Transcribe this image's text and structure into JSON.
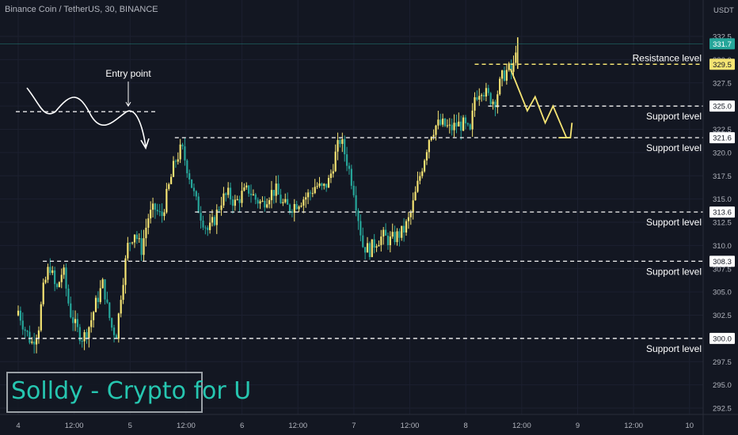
{
  "header": {
    "symbol": "Binance Coin / TetherUS, 30, BINANCE",
    "currency": "USDT"
  },
  "watermark": "Solldy - Crypto for U",
  "colors": {
    "up": "#f5e473",
    "down": "#26a69a",
    "background": "#131722",
    "level_line": "#e6e6e6",
    "resistance_line": "#f5e473",
    "annotation": "#f5e473",
    "price_tag": "#26a69a"
  },
  "chart_data": {
    "type": "candlestick",
    "title": "Binance Coin / TetherUS, 30, BINANCE",
    "ylabel": "USDT",
    "ylim": [
      291.5,
      334.5
    ],
    "x_ticks": [
      "4",
      "12:00",
      "5",
      "12:00",
      "6",
      "12:00",
      "7",
      "12:00",
      "8",
      "12:00",
      "9",
      "12:00",
      "10"
    ],
    "y_ticks": [
      292.5,
      295.0,
      297.5,
      300.0,
      302.5,
      305.0,
      307.5,
      310.0,
      312.5,
      315.0,
      317.5,
      320.0,
      322.5,
      325.0,
      327.5,
      330.0,
      332.5
    ],
    "last_price": 331.7,
    "price_markers": [
      331.7,
      329.5,
      325.0,
      321.6,
      313.6,
      308.3,
      300.0
    ],
    "levels": [
      {
        "label": "Resistance level",
        "price": 329.5,
        "kind": "resistance"
      },
      {
        "label": "Support level",
        "price": 325.0,
        "kind": "support"
      },
      {
        "label": "Support level",
        "price": 321.6,
        "kind": "support"
      },
      {
        "label": "Support level",
        "price": 313.6,
        "kind": "support"
      },
      {
        "label": "Support level",
        "price": 308.3,
        "kind": "support"
      },
      {
        "label": "Support level",
        "price": 300.0,
        "kind": "support"
      }
    ],
    "annotations": [
      {
        "text": "Entry point",
        "price": 324.4
      }
    ],
    "path_points": [
      {
        "day": 4.0,
        "price": 303.0
      },
      {
        "day": 4.06,
        "price": 301.0
      },
      {
        "day": 4.12,
        "price": 299.5
      },
      {
        "day": 4.18,
        "price": 301.0
      },
      {
        "day": 4.22,
        "price": 305.0
      },
      {
        "day": 4.28,
        "price": 308.0
      },
      {
        "day": 4.34,
        "price": 305.0
      },
      {
        "day": 4.4,
        "price": 307.5
      },
      {
        "day": 4.46,
        "price": 303.0
      },
      {
        "day": 4.52,
        "price": 301.0
      },
      {
        "day": 4.58,
        "price": 300.0
      },
      {
        "day": 4.64,
        "price": 301.5
      },
      {
        "day": 4.7,
        "price": 304.0
      },
      {
        "day": 4.76,
        "price": 306.0
      },
      {
        "day": 4.8,
        "price": 303.0
      },
      {
        "day": 4.84,
        "price": 301.0
      },
      {
        "day": 4.88,
        "price": 300.5
      },
      {
        "day": 4.92,
        "price": 305.0
      },
      {
        "day": 4.98,
        "price": 310.0
      },
      {
        "day": 5.04,
        "price": 311.5
      },
      {
        "day": 5.1,
        "price": 309.5
      },
      {
        "day": 5.16,
        "price": 313.0
      },
      {
        "day": 5.22,
        "price": 314.0
      },
      {
        "day": 5.28,
        "price": 313.0
      },
      {
        "day": 5.34,
        "price": 316.0
      },
      {
        "day": 5.4,
        "price": 319.0
      },
      {
        "day": 5.46,
        "price": 320.5
      },
      {
        "day": 5.52,
        "price": 318.0
      },
      {
        "day": 5.58,
        "price": 315.0
      },
      {
        "day": 5.64,
        "price": 313.0
      },
      {
        "day": 5.7,
        "price": 311.5
      },
      {
        "day": 5.76,
        "price": 313.0
      },
      {
        "day": 5.82,
        "price": 315.0
      },
      {
        "day": 5.88,
        "price": 315.5
      },
      {
        "day": 5.94,
        "price": 314.5
      },
      {
        "day": 6.0,
        "price": 315.5
      },
      {
        "day": 6.06,
        "price": 316.0
      },
      {
        "day": 6.12,
        "price": 315.0
      },
      {
        "day": 6.18,
        "price": 314.5
      },
      {
        "day": 6.24,
        "price": 315.5
      },
      {
        "day": 6.3,
        "price": 316.0
      },
      {
        "day": 6.36,
        "price": 314.5
      },
      {
        "day": 6.42,
        "price": 314.0
      },
      {
        "day": 6.48,
        "price": 314.5
      },
      {
        "day": 6.54,
        "price": 315.0
      },
      {
        "day": 6.6,
        "price": 315.5
      },
      {
        "day": 6.66,
        "price": 316.5
      },
      {
        "day": 6.72,
        "price": 316.0
      },
      {
        "day": 6.78,
        "price": 317.0
      },
      {
        "day": 6.84,
        "price": 320.0
      },
      {
        "day": 6.88,
        "price": 321.5
      },
      {
        "day": 6.94,
        "price": 319.0
      },
      {
        "day": 7.0,
        "price": 316.0
      },
      {
        "day": 7.04,
        "price": 313.0
      },
      {
        "day": 7.08,
        "price": 310.0
      },
      {
        "day": 7.14,
        "price": 309.5
      },
      {
        "day": 7.2,
        "price": 310.5
      },
      {
        "day": 7.26,
        "price": 311.0
      },
      {
        "day": 7.32,
        "price": 310.5
      },
      {
        "day": 7.38,
        "price": 311.0
      },
      {
        "day": 7.44,
        "price": 311.5
      },
      {
        "day": 7.5,
        "price": 313.0
      },
      {
        "day": 7.56,
        "price": 316.0
      },
      {
        "day": 7.62,
        "price": 319.0
      },
      {
        "day": 7.68,
        "price": 322.0
      },
      {
        "day": 7.74,
        "price": 323.0
      },
      {
        "day": 7.8,
        "price": 323.0
      },
      {
        "day": 7.86,
        "price": 322.5
      },
      {
        "day": 7.92,
        "price": 323.0
      },
      {
        "day": 7.98,
        "price": 323.0
      },
      {
        "day": 8.04,
        "price": 322.0
      },
      {
        "day": 8.08,
        "price": 326.0
      },
      {
        "day": 8.14,
        "price": 327.0
      },
      {
        "day": 8.2,
        "price": 326.0
      },
      {
        "day": 8.26,
        "price": 325.5
      },
      {
        "day": 8.32,
        "price": 328.0
      },
      {
        "day": 8.38,
        "price": 329.0
      },
      {
        "day": 8.42,
        "price": 328.5
      },
      {
        "day": 8.45,
        "price": 331.7
      }
    ]
  }
}
